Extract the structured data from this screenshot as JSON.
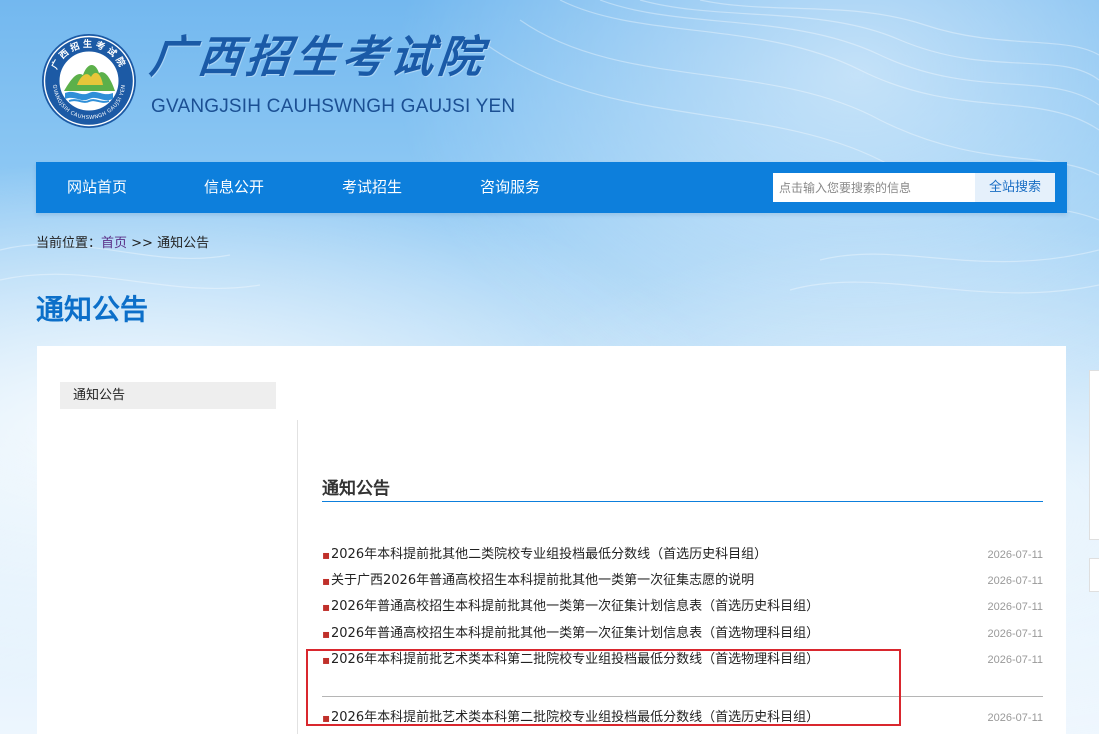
{
  "header": {
    "title_cn": "广西招生考试院",
    "title_en": "GVANGJSIH CAUHSWNGH GAUJSI YEN",
    "seal_text_top": "广西招生考试院",
    "seal_text_bottom": "GVANGJSIH CAUHSWNGH GAUJSI YEN"
  },
  "nav": {
    "items": [
      {
        "label": "网站首页"
      },
      {
        "label": "信息公开"
      },
      {
        "label": "考试招生"
      },
      {
        "label": "咨询服务"
      }
    ],
    "search": {
      "placeholder": "点击输入您要搜索的信息",
      "button_label": "全站搜索"
    }
  },
  "breadcrumb": {
    "prefix": "当前位置：",
    "home": "首页",
    "separator": " >> ",
    "current": "通知公告"
  },
  "page": {
    "title": "通知公告"
  },
  "sidebar": {
    "items": [
      {
        "label": "通知公告"
      }
    ]
  },
  "section": {
    "title": "通知公告"
  },
  "news": {
    "bullet": "▪",
    "items": [
      {
        "title": "2026年本科提前批其他二类院校专业组投档最低分数线（首选历史科目组）",
        "date": "2026-07-11"
      },
      {
        "title": "关于广西2026年普通高校招生本科提前批其他一类第一次征集志愿的说明",
        "date": "2026-07-11"
      },
      {
        "title": "2026年普通高校招生本科提前批其他一类第一次征集计划信息表（首选历史科目组）",
        "date": "2026-07-11"
      },
      {
        "title": "2026年普通高校招生本科提前批其他一类第一次征集计划信息表（首选物理科目组）",
        "date": "2026-07-11"
      },
      {
        "title": "2026年本科提前批艺术类本科第二批院校专业组投档最低分数线（首选物理科目组）",
        "date": "2026-07-11"
      },
      {
        "title": "2026年本科提前批艺术类本科第二批院校专业组投档最低分数线（首选历史科目组）",
        "date": "2026-07-11"
      }
    ]
  },
  "colors": {
    "nav_bg": "#0d7fdc",
    "title_blue": "#0c6fc9",
    "bullet_red": "#c0302a",
    "highlight_red": "#d9272e"
  }
}
